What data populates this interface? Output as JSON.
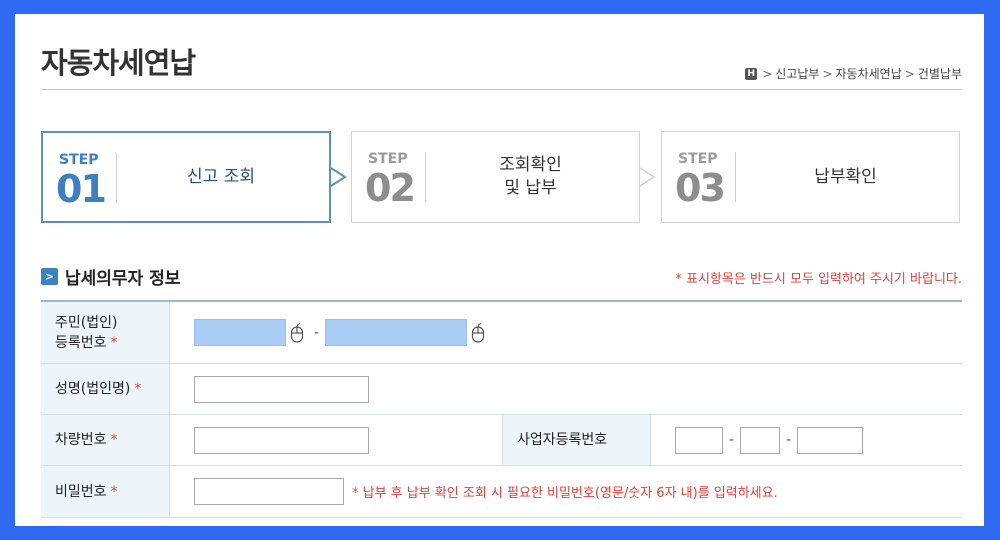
{
  "header": {
    "title": "자동차세연납",
    "breadcrumb": [
      "신고납부",
      "자동차세연납",
      "건별납부"
    ],
    "home_label": "H"
  },
  "steps": [
    {
      "word": "STEP",
      "number": "01",
      "label": "신고 조회",
      "active": true
    },
    {
      "word": "STEP",
      "number": "02",
      "label": "조회확인\n및 납부",
      "active": false
    },
    {
      "word": "STEP",
      "number": "03",
      "label": "납부확인",
      "active": false
    }
  ],
  "section": {
    "title": "납세의무자 정보",
    "required_note": "* 표시항목은 반드시 모두 입력하여 주시기 바랍니다."
  },
  "form": {
    "resident_number_label_1": "주민(법인)",
    "resident_number_label_2": "등록번호",
    "name_label": "성명(법인명)",
    "vehicle_number_label": "차량번호",
    "business_number_label": "사업자등록번호",
    "password_label": "비밀번호",
    "required_mark": "*",
    "separator": "-",
    "password_hint": "* 납부 후 납부 확인 조회 시 필요한 비밀번호(영문/숫자 6자 내)를 입력하세요."
  },
  "colors": {
    "frame": "#2f6af0",
    "active_step": "#3d7fc1",
    "required": "#e2403a",
    "label_bg": "#edf5fa",
    "masked_input": "#a9cdf4"
  }
}
